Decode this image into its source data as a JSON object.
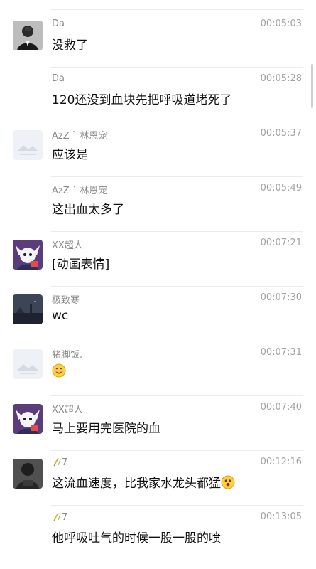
{
  "messages": [
    {
      "sender": "Da",
      "time": "00:05:03",
      "text": "没救了",
      "avatar": "person-photo"
    },
    {
      "sender": "Da",
      "time": "00:05:28",
      "text": "120还没到血块先把呼吸道堵死了",
      "avatar": "none"
    },
    {
      "sender": "AzZ ` 林恩宠",
      "time": "00:05:37",
      "text": "应该是",
      "avatar": "placeholder-image"
    },
    {
      "sender": "AzZ ` 林恩宠",
      "time": "00:05:49",
      "text": "这出血太多了",
      "avatar": "none"
    },
    {
      "sender": "XX超人",
      "time": "00:07:21",
      "text": "[动画表情]",
      "avatar": "anime-character"
    },
    {
      "sender": "极致寒",
      "time": "00:07:30",
      "text": "wc",
      "avatar": "night-scene"
    },
    {
      "sender": "猪脚饭.",
      "time": "00:07:31",
      "text": "",
      "avatar": "placeholder-image",
      "emoji": "smiling-face-emoji"
    },
    {
      "sender": "XX超人",
      "time": "00:07:40",
      "text": "马上要用完医院的血",
      "avatar": "anime-character"
    },
    {
      "sender": "7",
      "time": "00:12:16",
      "text": "这流血速度，比我家水龙头都猛",
      "avatar": "dark-figure",
      "sender_icon": "rice-ear-icon",
      "emoji": "shocked-face-emoji"
    },
    {
      "sender": "7",
      "time": "00:13:05",
      "text": "他呼吸吐气的时候一股一股的喷",
      "avatar": "none",
      "sender_icon": "rice-ear-icon"
    }
  ],
  "colors": {
    "background": "#ffffff",
    "text": "#111111",
    "meta": "#8a8a8a",
    "divider": "#ececec"
  }
}
